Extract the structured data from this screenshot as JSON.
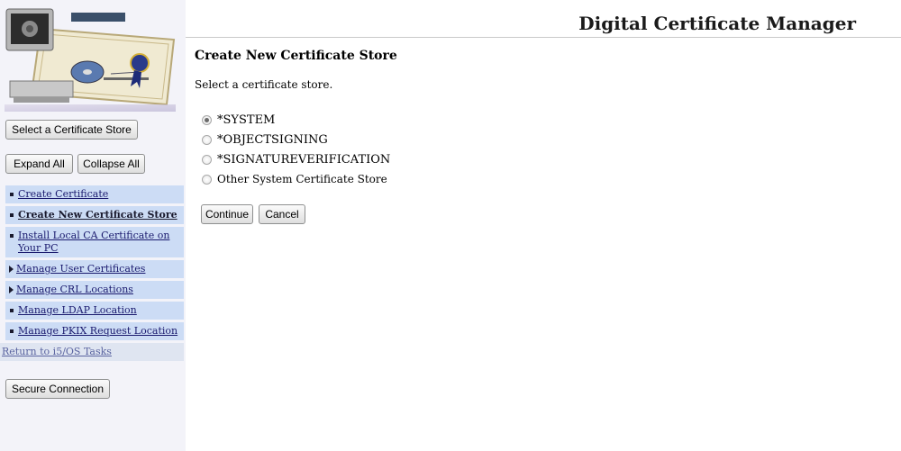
{
  "header": {
    "title": "Digital Certificate Manager"
  },
  "sidebar": {
    "select_store_button": "Select a Certificate Store",
    "expand_all_button": "Expand All",
    "collapse_all_button": "Collapse All",
    "nav": [
      {
        "label": "Create Certificate",
        "marker": "bullet",
        "current": false
      },
      {
        "label": "Create New Certificate Store",
        "marker": "bullet",
        "current": true
      },
      {
        "label": "Install Local CA Certificate on Your PC",
        "marker": "bullet",
        "current": false
      },
      {
        "label": "Manage User Certificates",
        "marker": "arrow",
        "current": false
      },
      {
        "label": "Manage CRL Locations",
        "marker": "arrow",
        "current": false
      },
      {
        "label": "Manage LDAP Location",
        "marker": "bullet",
        "current": false
      },
      {
        "label": "Manage PKIX Request Location",
        "marker": "bullet",
        "current": false
      }
    ],
    "return_link": "Return to i5/OS Tasks",
    "secure_connection_button": "Secure Connection"
  },
  "main": {
    "title": "Create New Certificate Store",
    "instruction": "Select a certificate store.",
    "options": [
      {
        "label": "*SYSTEM",
        "checked": true
      },
      {
        "label": "*OBJECTSIGNING",
        "checked": false
      },
      {
        "label": "*SIGNATUREVERIFICATION",
        "checked": false
      },
      {
        "label": "Other System Certificate Store",
        "checked": false
      }
    ],
    "continue_button": "Continue",
    "cancel_button": "Cancel"
  },
  "colors": {
    "sidebar_bg": "#f3f3f9",
    "nav_item_bg": "#ccdcf5",
    "link": "#1a1a6e"
  }
}
